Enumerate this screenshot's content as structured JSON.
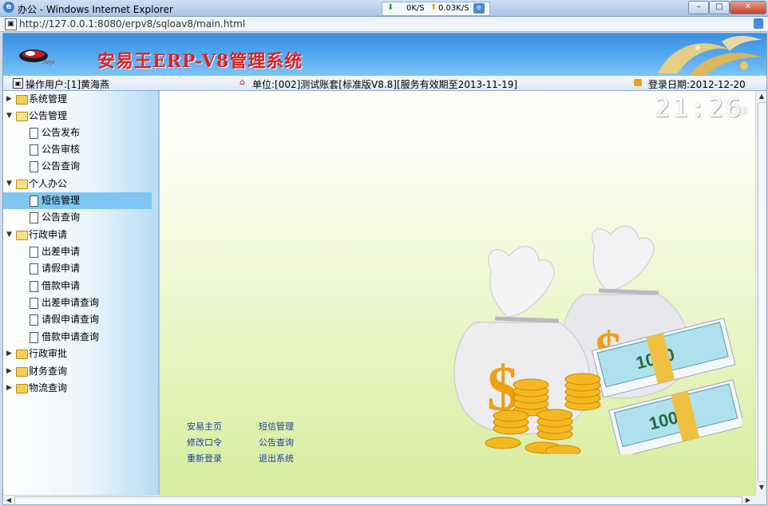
{
  "window": {
    "title": "办公 - Windows Internet Explorer",
    "net_down": "0K/S",
    "net_up": "0.03K/S",
    "minimize_icon": "minimize-icon",
    "maximize_icon": "maximize-icon",
    "close_icon": "close-icon"
  },
  "address": {
    "url": "http://127.0.0.1:8080/erpv8/sqloav8/main.html"
  },
  "banner": {
    "brand_small": "Anyi",
    "title": "安易王ERP-V8管理系统"
  },
  "infobar": {
    "user": "操作用户:[1]黄海燕",
    "unit": "单位:[002]测试账套[标准版V8.8][服务有效期至2013-11-19]",
    "login_date": "登录日期:2012-12-20"
  },
  "tree": [
    {
      "label": "系统管理",
      "type": "folder",
      "open": false,
      "level": 0
    },
    {
      "label": "公告管理",
      "type": "folder",
      "open": true,
      "level": 0
    },
    {
      "label": "公告发布",
      "type": "doc",
      "level": 1
    },
    {
      "label": "公告审核",
      "type": "doc",
      "level": 1
    },
    {
      "label": "公告查询",
      "type": "doc",
      "level": 1
    },
    {
      "label": "个人办公",
      "type": "folder",
      "open": true,
      "level": 0
    },
    {
      "label": "短信管理",
      "type": "doc",
      "level": 1,
      "selected": true
    },
    {
      "label": "公告查询",
      "type": "doc",
      "level": 1
    },
    {
      "label": "行政申请",
      "type": "folder",
      "open": true,
      "level": 0
    },
    {
      "label": "出差申请",
      "type": "doc",
      "level": 1
    },
    {
      "label": "请假申请",
      "type": "doc",
      "level": 1
    },
    {
      "label": "借款申请",
      "type": "doc",
      "level": 1
    },
    {
      "label": "出差申请查询",
      "type": "doc",
      "level": 1
    },
    {
      "label": "请假申请查询",
      "type": "doc",
      "level": 1
    },
    {
      "label": "借款申请查询",
      "type": "doc",
      "level": 1
    },
    {
      "label": "行政审批",
      "type": "folder",
      "open": false,
      "level": 0
    },
    {
      "label": "财务查询",
      "type": "folder",
      "open": false,
      "level": 0
    },
    {
      "label": "物流查询",
      "type": "folder",
      "open": false,
      "level": 0
    }
  ],
  "clock": {
    "time": "21:26",
    "seconds": "10"
  },
  "quicklinks": {
    "home": "安易主页",
    "sms": "短信管理",
    "change_password": "修改口令",
    "notice_query": "公告查询",
    "relogin": "重新登录",
    "logout": "退出系统"
  },
  "banknote_text": "1000",
  "colors": {
    "brand_red": "#e02020",
    "banner_blue": "#3a8de0",
    "selected_row": "#7fc6f2",
    "link_blue": "#1a3fa0"
  }
}
